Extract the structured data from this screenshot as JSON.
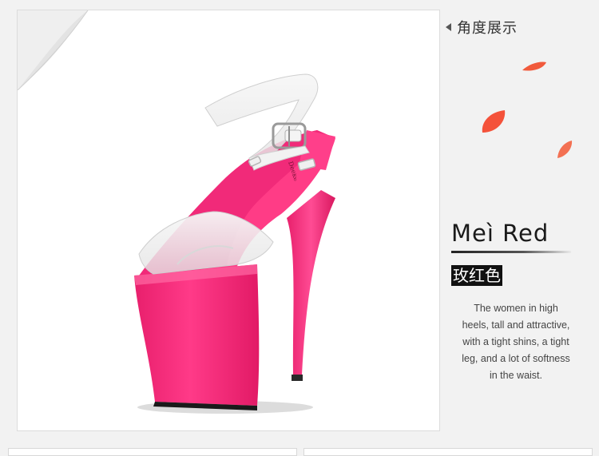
{
  "product": {
    "angle_label": "角度展示",
    "color_name_en": "Meì Red",
    "color_name_cn": "玫红色",
    "description": "The women in high heels, tall and attractive, with a tight shins, a tight leg, and a lot of softness in the waist.",
    "insole_logo": "Deeke"
  },
  "colors": {
    "accent": "#ff2e7e",
    "platform": "#ff2c80",
    "petal": "#f4523a",
    "page_bg": "#f2f2f2"
  },
  "icons": [
    "triangle-left-icon",
    "page-curl-icon",
    "petal-icon"
  ]
}
